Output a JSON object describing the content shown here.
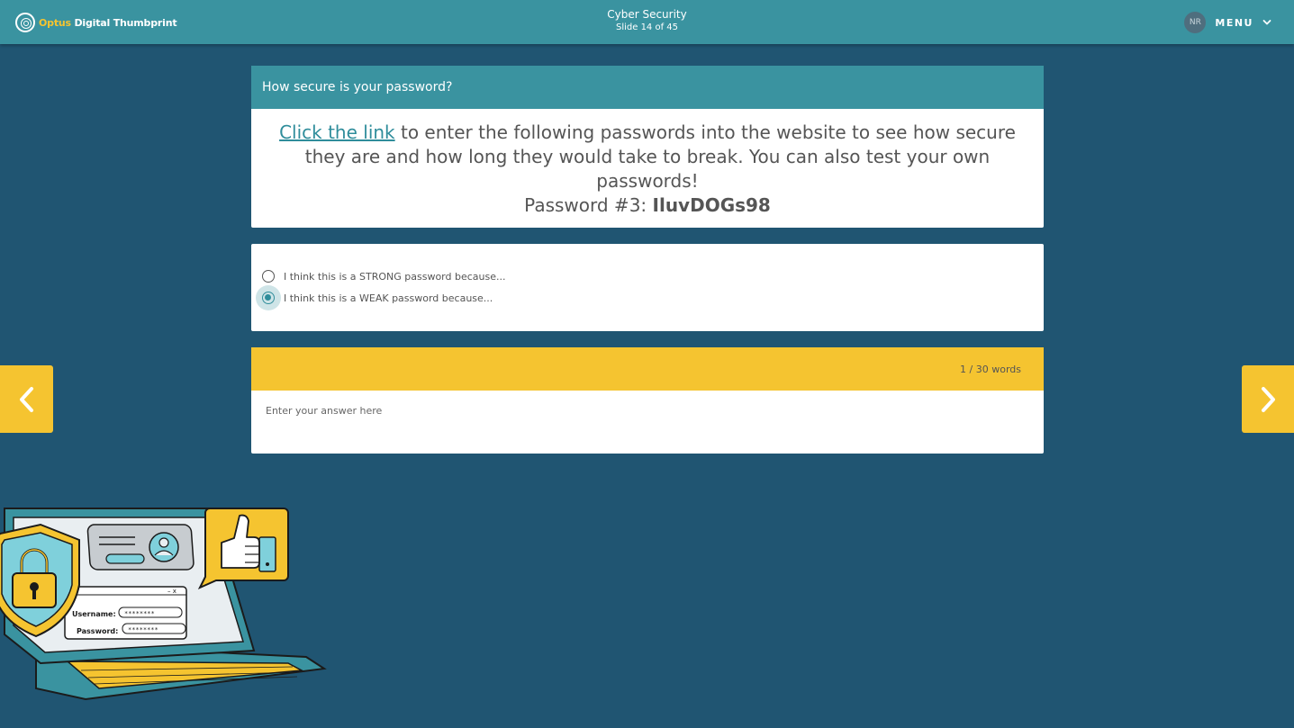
{
  "header": {
    "logo_brand": "Optus",
    "logo_rest": " Digital Thumbprint",
    "course_title": "Cyber Security",
    "slide_info": "Slide 14 of 45",
    "user_initials": "NR",
    "menu_label": "MENU"
  },
  "question": {
    "heading": "How secure is your password?",
    "link_text": "Click the link",
    "instruction": " to enter the following passwords into the website to see how secure they are and how long they would take to break. You can also test your own passwords!",
    "password_label": "Password #3: ",
    "password_value": "IluvDOGs98"
  },
  "options": [
    {
      "label": "I think this is a STRONG password because...",
      "selected": false
    },
    {
      "label": "I think this is a WEAK password because...",
      "selected": true
    }
  ],
  "answer": {
    "word_count": "1 / 30 words",
    "placeholder": "Enter your answer here"
  },
  "illustration": {
    "username_label": "Username:",
    "password_label": "Password:",
    "masked_value": "********"
  },
  "colors": {
    "background": "#205572",
    "header": "#3a93a0",
    "accent_yellow": "#f5c430",
    "link": "#2f8d9b"
  }
}
